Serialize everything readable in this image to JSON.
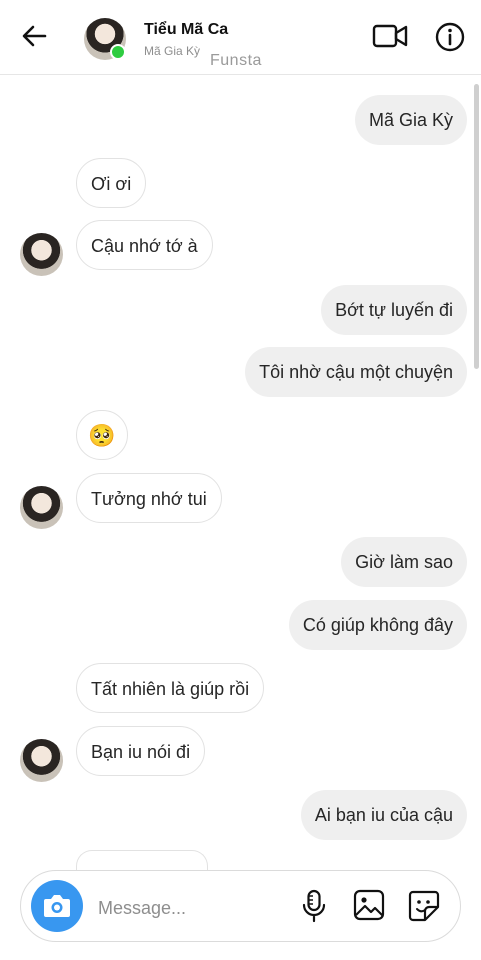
{
  "header": {
    "name": "Tiểu Mã Ca",
    "subtitle": "Mã Gia Kỳ",
    "watermark": "Funsta",
    "icons": [
      "back-arrow-icon",
      "video-call-icon",
      "info-icon"
    ]
  },
  "messages": [
    {
      "side": "out",
      "text": "Mã Gia Kỳ"
    },
    {
      "side": "in",
      "text": "Ơi ơi"
    },
    {
      "side": "in",
      "text": "Cậu nhớ tớ à"
    },
    {
      "side": "out",
      "text": "Bớt tự luyến đi"
    },
    {
      "side": "out",
      "text": "Tôi nhờ cậu một chuyện"
    },
    {
      "side": "in",
      "text": "🥺"
    },
    {
      "side": "in",
      "text": "Tưởng nhớ tui"
    },
    {
      "side": "out",
      "text": "Giờ làm sao"
    },
    {
      "side": "out",
      "text": "Có giúp không đây"
    },
    {
      "side": "in",
      "text": "Tất nhiên là giúp rồi"
    },
    {
      "side": "in",
      "text": "Bạn iu nói đi"
    },
    {
      "side": "out",
      "text": "Ai bạn iu của cậu"
    }
  ],
  "composer": {
    "placeholder": "Message...",
    "icons": [
      "camera-icon",
      "microphone-icon",
      "gallery-icon",
      "sticker-icon"
    ]
  }
}
